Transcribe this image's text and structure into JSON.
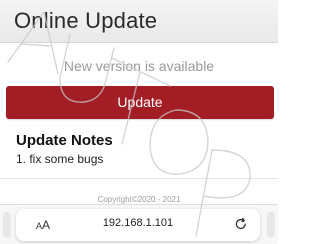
{
  "header": {
    "title": "Online Update"
  },
  "status": {
    "message": "New version is available"
  },
  "actions": {
    "update_label": "Update"
  },
  "notes": {
    "heading": "Update Notes",
    "items": [
      "1. fix some bugs"
    ]
  },
  "footer": {
    "copyright": "Copyright©2020 - 2021"
  },
  "browser": {
    "text_size_label_small": "A",
    "text_size_label_large": "A",
    "url": "192.168.1.101",
    "reload_icon": "reload-icon"
  },
  "watermark": {
    "text": "AUTOP"
  },
  "colors": {
    "accent": "#a31d24",
    "title_bar": "#ededed",
    "muted_text": "#9a9a9a"
  }
}
